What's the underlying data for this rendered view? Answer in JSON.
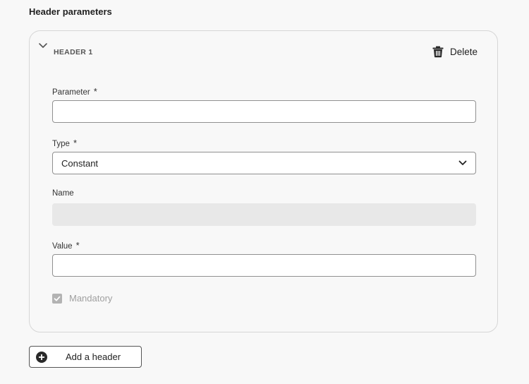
{
  "section": {
    "title": "Header parameters"
  },
  "header_card": {
    "label": "HEADER 1",
    "delete_label": "Delete",
    "fields": {
      "parameter": {
        "label": "Parameter",
        "required_mark": "*",
        "value": "",
        "placeholder": ""
      },
      "type": {
        "label": "Type",
        "required_mark": "*",
        "selected": "Constant"
      },
      "name": {
        "label": "Name",
        "value": ""
      },
      "value": {
        "label": "Value",
        "required_mark": "*",
        "value": "",
        "placeholder": ""
      }
    },
    "mandatory": {
      "label": "Mandatory",
      "checked": true
    }
  },
  "add_button": {
    "label": "Add a header"
  },
  "icons": {
    "collapse": "chevron-down-icon",
    "delete": "trash-icon",
    "select": "chevron-down-icon",
    "check": "checkmark-icon",
    "add": "add-circle-icon"
  },
  "colors": {
    "background": "#f8f8f8",
    "card_border": "#d6d6d6",
    "input_border": "#909090",
    "disabled_fill": "#e8e8e8",
    "checkbox_disabled": "#b3b3b3"
  }
}
